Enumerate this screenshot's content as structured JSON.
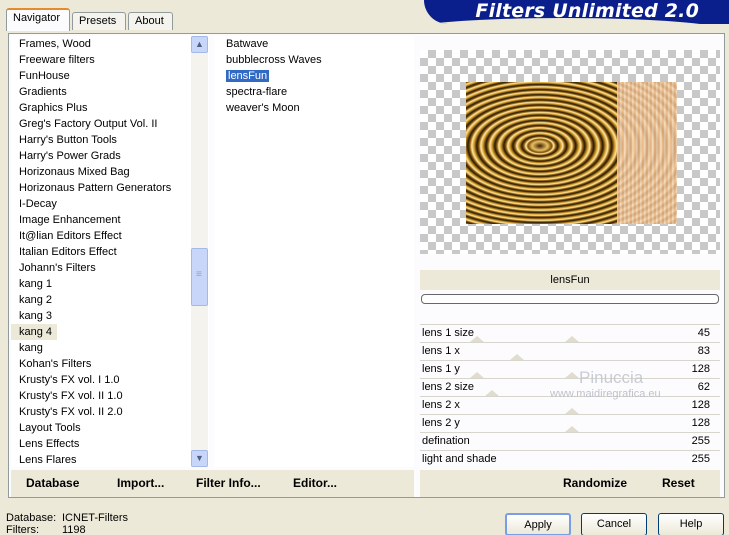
{
  "tabs": [
    "Navigator",
    "Presets",
    "About"
  ],
  "banner": {
    "title": "Filters Unlimited 2.0"
  },
  "categories": [
    "Frames, Wood",
    "Freeware filters",
    "FunHouse",
    "Gradients",
    "Graphics Plus",
    "Greg's Factory Output Vol. II",
    "Harry's Button Tools",
    "Harry's Power Grads",
    "Horizonaus Mixed Bag",
    "Horizonaus Pattern Generators",
    "I-Decay",
    "Image Enhancement",
    "It@lian Editors Effect",
    "Italian Editors Effect",
    "Johann's Filters",
    "kang 1",
    "kang 2",
    "kang 3",
    "kang 4",
    "kang",
    "Kohan's Filters",
    "Krusty's FX vol. I 1.0",
    "Krusty's FX vol. II 1.0",
    "Krusty's FX vol. II 2.0",
    "Layout Tools",
    "Lens Effects",
    "Lens Flares"
  ],
  "selected_category": "kang 4",
  "filters": [
    "Batwave",
    "bubblecross Waves",
    "lensFun",
    "spectra-flare",
    "weaver's Moon"
  ],
  "selected_filter": "lensFun",
  "filter_title": "lensFun",
  "params": [
    {
      "label": "lens 1 size",
      "value": "45"
    },
    {
      "label": "lens 1 x",
      "value": "83"
    },
    {
      "label": "lens 1 y",
      "value": "128"
    },
    {
      "label": "lens 2 size",
      "value": "62"
    },
    {
      "label": "lens 2 x",
      "value": "128"
    },
    {
      "label": "lens 2 y",
      "value": "128"
    },
    {
      "label": "defination",
      "value": "255"
    },
    {
      "label": "light and shade",
      "value": "255"
    }
  ],
  "left_buttons": {
    "database": "Database",
    "import": "Import...",
    "filter_info": "Filter Info...",
    "editor": "Editor..."
  },
  "right_buttons": {
    "randomize": "Randomize",
    "reset": "Reset"
  },
  "status": {
    "database_label": "Database:",
    "database_value": "ICNET-Filters",
    "filters_label": "Filters:",
    "filters_value": "1198"
  },
  "dialog_buttons": {
    "apply": "Apply",
    "cancel": "Cancel",
    "help": "Help"
  },
  "watermark": {
    "name": "Pinuccia",
    "url": "www.maidiregrafica.eu"
  }
}
